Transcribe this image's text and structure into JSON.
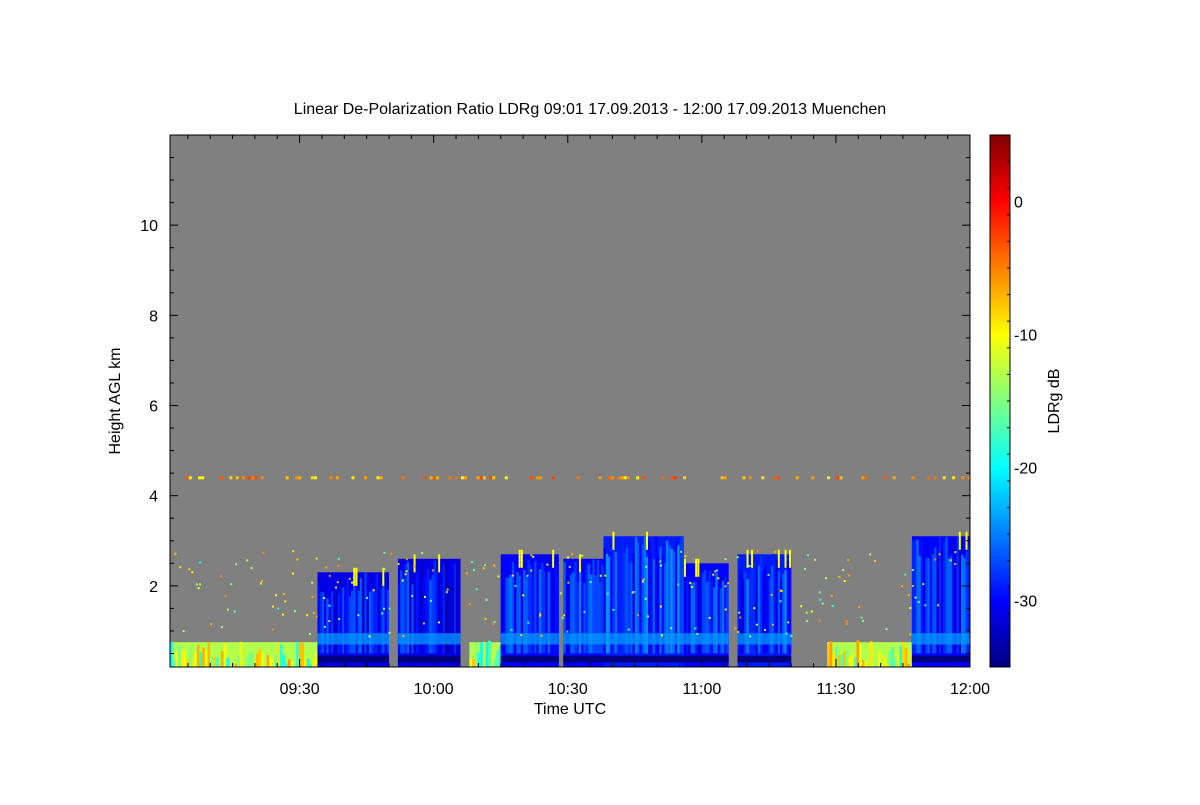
{
  "chart_data": {
    "type": "heatmap",
    "title": "Linear De-Polarization Ratio LDRg   09:01 17.09.2013 - 12:00 17.09.2013 Muenchen",
    "xlabel": "Time UTC",
    "ylabel": "Height AGL km",
    "colorbar_label": "LDRg dB",
    "x_range": [
      "09:01",
      "12:00"
    ],
    "ylim": [
      0.2,
      12.0
    ],
    "x_ticks": [
      "09:30",
      "10:00",
      "10:30",
      "11:00",
      "11:30",
      "12:00"
    ],
    "y_ticks": [
      2,
      4,
      6,
      8,
      10
    ],
    "colorbar_ticks": [
      0,
      -10,
      -20,
      -30
    ],
    "colorbar_range": [
      -35,
      5
    ],
    "background_color": "#808080",
    "colormap": [
      "#000080",
      "#0000ff",
      "#0080ff",
      "#00ffff",
      "#80ff80",
      "#ffff00",
      "#ff8000",
      "#ff0000",
      "#800000"
    ],
    "cloud_regions": [
      {
        "start": "09:34",
        "end": "09:50",
        "top_km": 2.3,
        "value_db": -31
      },
      {
        "start": "09:52",
        "end": "10:06",
        "top_km": 2.6,
        "value_db": -31
      },
      {
        "start": "10:15",
        "end": "10:28",
        "top_km": 2.7,
        "value_db": -30
      },
      {
        "start": "10:29",
        "end": "10:38",
        "top_km": 2.6,
        "value_db": -30
      },
      {
        "start": "10:38",
        "end": "10:56",
        "top_km": 3.1,
        "value_db": -29
      },
      {
        "start": "10:56",
        "end": "11:06",
        "top_km": 2.5,
        "value_db": -30
      },
      {
        "start": "11:08",
        "end": "11:20",
        "top_km": 2.7,
        "value_db": -29
      },
      {
        "start": "11:47",
        "end": "12:00",
        "top_km": 3.1,
        "value_db": -30
      }
    ],
    "cloud_base_layer": {
      "bottom_km": 0.7,
      "top_km": 0.95,
      "value_db": -24
    },
    "aerosol_layer": {
      "top_km": 0.75,
      "value_db": -13
    },
    "elevated_layer": {
      "height_km": 4.4,
      "value_db": -6
    },
    "cloud_top_values_db": -10
  }
}
